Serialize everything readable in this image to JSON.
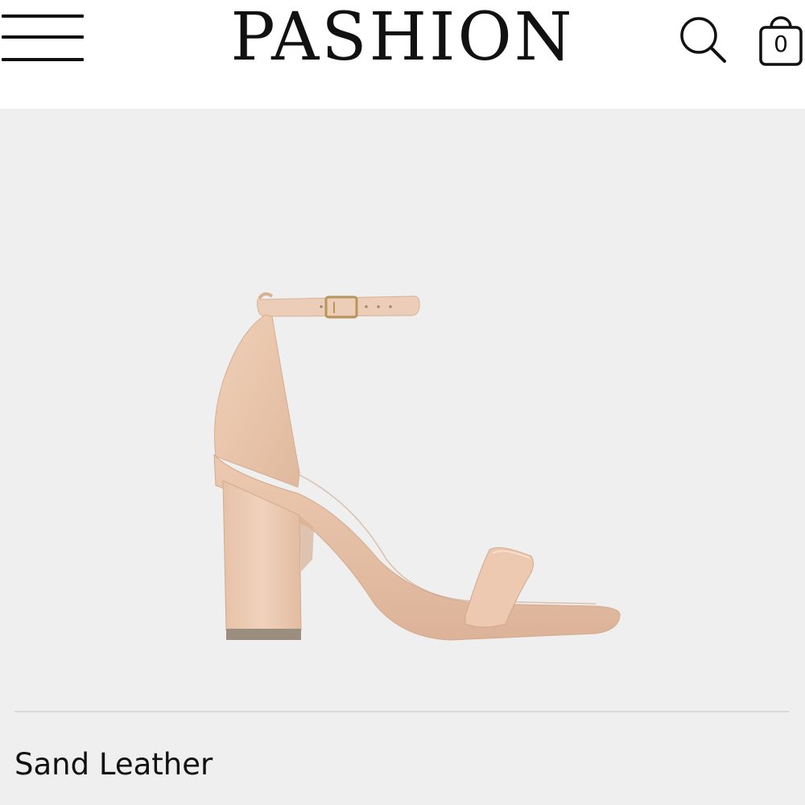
{
  "header": {
    "brand": "PASHION",
    "menu_icon": "hamburger-menu-icon",
    "search_icon": "search-icon",
    "bag_icon": "shopping-bag-icon",
    "bag_count": "0"
  },
  "product": {
    "name": "Sand Leather",
    "image": "beige-block-heel-ankle-strap-sandal"
  },
  "colors": {
    "header_bg": "#ffffff",
    "page_bg": "#efefef",
    "shoe_leather": "#e8c6ad",
    "heel_tip": "#9c8e7e",
    "buckle": "#b8955a",
    "text": "#111111"
  }
}
